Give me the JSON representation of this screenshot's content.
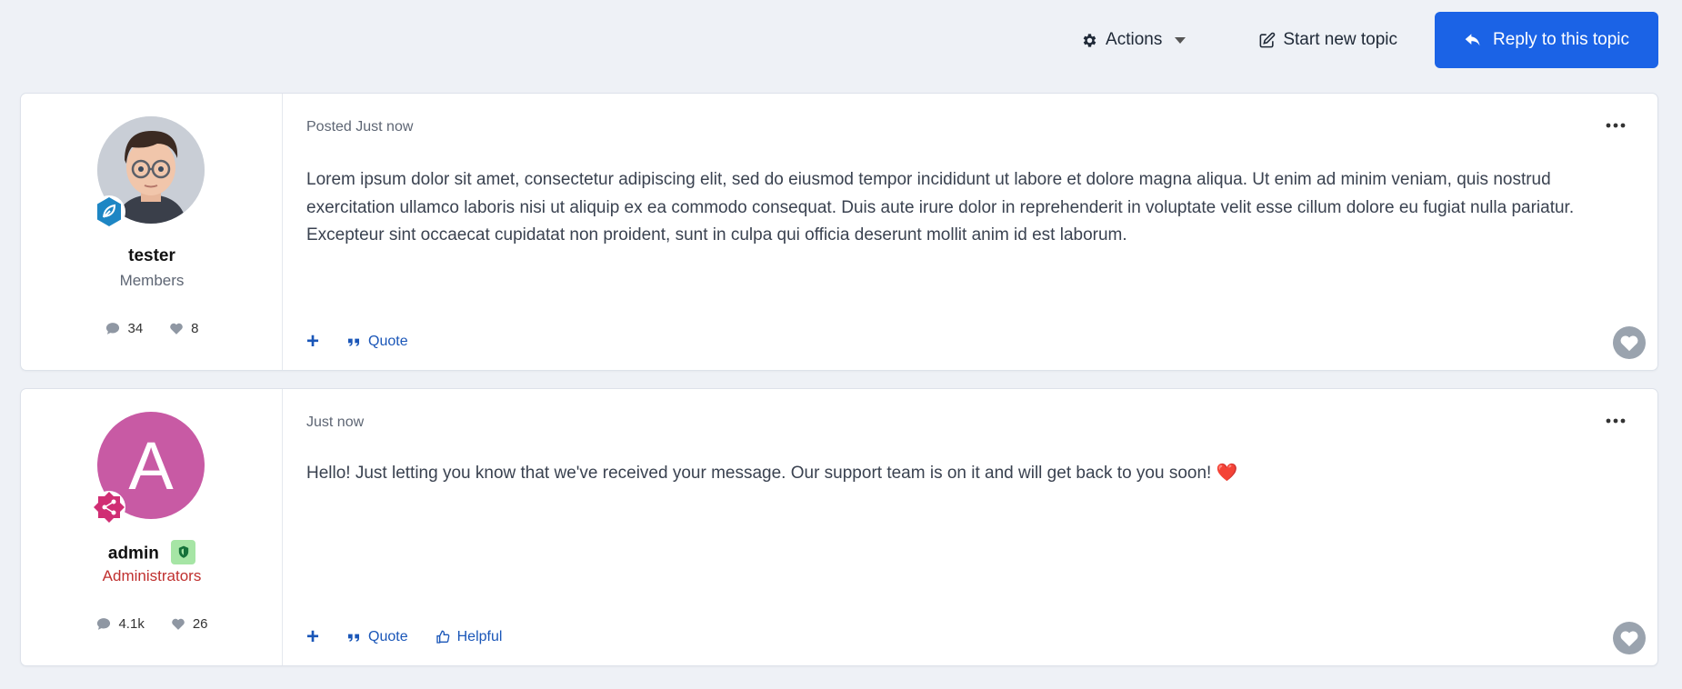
{
  "toolbar": {
    "actions_label": "Actions",
    "start_topic_label": "Start new topic",
    "reply_label": "Reply to this topic"
  },
  "posts": [
    {
      "author": "tester",
      "group": "Members",
      "comments": "34",
      "likes": "8",
      "meta": "Posted Just now",
      "content": "Lorem ipsum dolor sit amet, consectetur adipiscing elit, sed do eiusmod tempor incididunt ut labore et dolore magna aliqua. Ut enim ad minim veniam, quis nostrud exercitation ullamco laboris nisi ut aliquip ex ea commodo consequat. Duis aute irure dolor in reprehenderit in voluptate velit esse cillum dolore eu fugiat nulla pariatur. Excepteur sint occaecat cupidatat non proident, sunt in culpa qui officia deserunt mollit anim id est laborum.",
      "actions": {
        "plus": "+",
        "quote": "Quote"
      }
    },
    {
      "author": "admin",
      "avatar_letter": "A",
      "group": "Administrators",
      "comments": "4.1k",
      "likes": "26",
      "meta": "Just now",
      "content": "Hello! Just letting you know that we've received your message. Our support team is on it and will get back to you soon! ❤️",
      "actions": {
        "plus": "+",
        "quote": "Quote",
        "helpful": "Helpful"
      }
    }
  ],
  "colors": {
    "primary": "#1b63e6",
    "link": "#1a56b8",
    "admin_group": "#c0302f",
    "avatar_admin": "#c85aa4"
  }
}
